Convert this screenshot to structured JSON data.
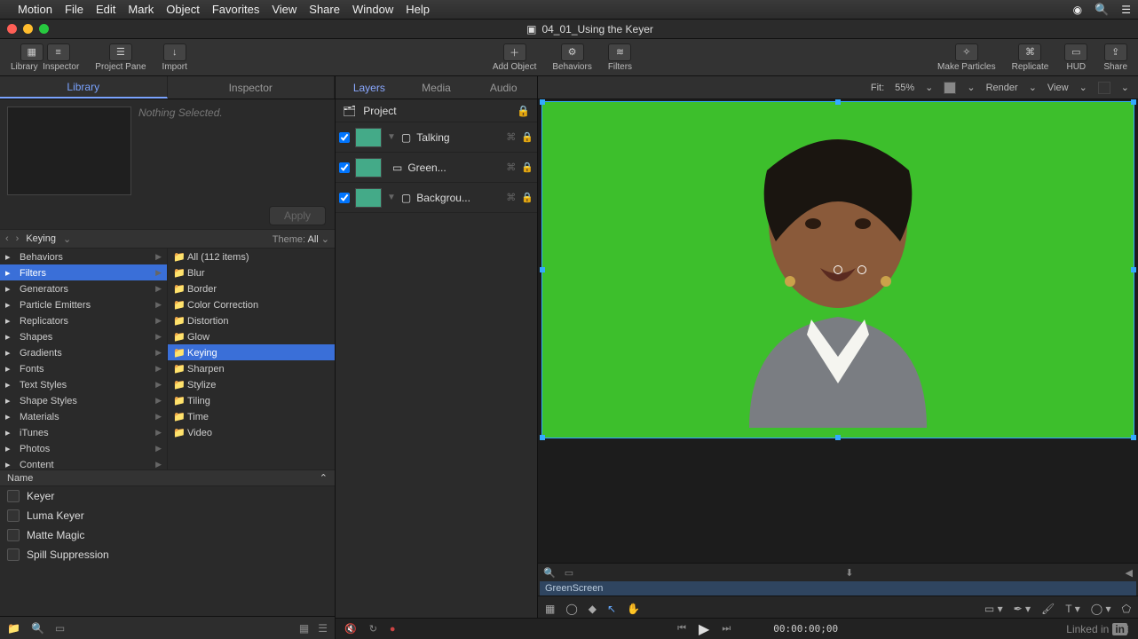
{
  "menubar": {
    "app": "Motion",
    "items": [
      "File",
      "Edit",
      "Mark",
      "Object",
      "Favorites",
      "View",
      "Share",
      "Window",
      "Help"
    ]
  },
  "window": {
    "title": "04_01_Using the Keyer"
  },
  "toolbar": {
    "library": "Library",
    "inspector": "Inspector",
    "projectpane": "Project Pane",
    "import": "Import",
    "addobject": "Add Object",
    "behaviors": "Behaviors",
    "filters": "Filters",
    "makeparticles": "Make Particles",
    "replicate": "Replicate",
    "hud": "HUD",
    "share": "Share"
  },
  "lefttabs": {
    "library": "Library",
    "inspector": "Inspector"
  },
  "preview": {
    "nothing": "Nothing Selected.",
    "apply": "Apply"
  },
  "breadcrumb": {
    "path": "Keying",
    "theme_label": "Theme:",
    "theme_value": "All"
  },
  "categories_left": [
    "Behaviors",
    "Filters",
    "Generators",
    "Particle Emitters",
    "Replicators",
    "Shapes",
    "Gradients",
    "Fonts",
    "Text Styles",
    "Shape Styles",
    "Materials",
    "iTunes",
    "Photos",
    "Content"
  ],
  "categories_left_selected": 1,
  "categories_right": [
    "All (112 items)",
    "Blur",
    "Border",
    "Color Correction",
    "Distortion",
    "Glow",
    "Keying",
    "Sharpen",
    "Stylize",
    "Tiling",
    "Time",
    "Video"
  ],
  "categories_right_selected": 6,
  "name_header": "Name",
  "name_items": [
    "Keyer",
    "Luma Keyer",
    "Matte Magic",
    "Spill Suppression"
  ],
  "midtabs": {
    "layers": "Layers",
    "media": "Media",
    "audio": "Audio"
  },
  "project_label": "Project",
  "layers": [
    {
      "name": "Talking",
      "type": "group"
    },
    {
      "name": "Green...",
      "type": "clip"
    },
    {
      "name": "Backgrou...",
      "type": "group"
    }
  ],
  "canvasbar": {
    "fit": "Fit:",
    "fitpct": "55%",
    "render": "Render",
    "view": "View"
  },
  "clip_label": "GreenScreen",
  "timecode": "00:00:00;00",
  "linkedin": "Linked in"
}
